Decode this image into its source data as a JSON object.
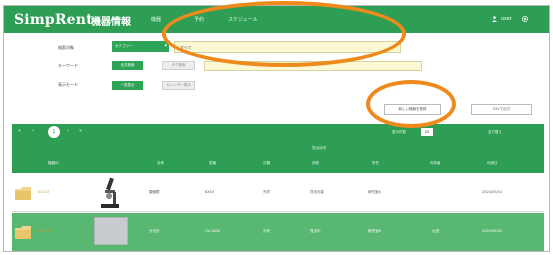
{
  "header": {
    "logo": "SimpRent",
    "subtitle": "機器情報",
    "nav": [
      "機器",
      "予約",
      "スケジュール"
    ],
    "user_label": "user"
  },
  "search": {
    "labels": [
      "検索対象",
      "キーワード",
      "表示モード"
    ],
    "category_value": "カテゴリー",
    "category_select_value": "すべて",
    "keyword_toggle_on": "全文検索",
    "keyword_toggle_off": "タグ検索",
    "mode_toggle_on": "一覧表示",
    "mode_toggle_off": "カレンダー表示"
  },
  "actions": {
    "new_button": "新しい機器を登録",
    "csv_button": "CSVで出力"
  },
  "pager": {
    "pages": [
      "«",
      "‹",
      "1",
      "›",
      "»"
    ],
    "current": "1",
    "info": "表示件数",
    "size": "20",
    "sort": "並び替え"
  },
  "table": {
    "group_label": "貸出状況",
    "columns": [
      "機器ID",
      "",
      "名称",
      "型番",
      "分類",
      "状態",
      "所在",
      "利用者",
      "利用日"
    ],
    "rows": [
      {
        "id": "00123",
        "name": "顕微鏡",
        "model": "BX53",
        "category": "光学",
        "status": "貸出可能",
        "location": "研究室A",
        "user": "-",
        "date": "2024/05/01"
      },
      {
        "id": "00124",
        "name": "分光計",
        "model": "UV-1800",
        "category": "分析",
        "status": "貸出中",
        "location": "研究室B",
        "user": "山田",
        "date": "2024/05/02"
      }
    ]
  },
  "colors": {
    "brand_green": "#2e9e55",
    "row_highlight": "#58b872",
    "annotation": "#ee8a1b"
  }
}
